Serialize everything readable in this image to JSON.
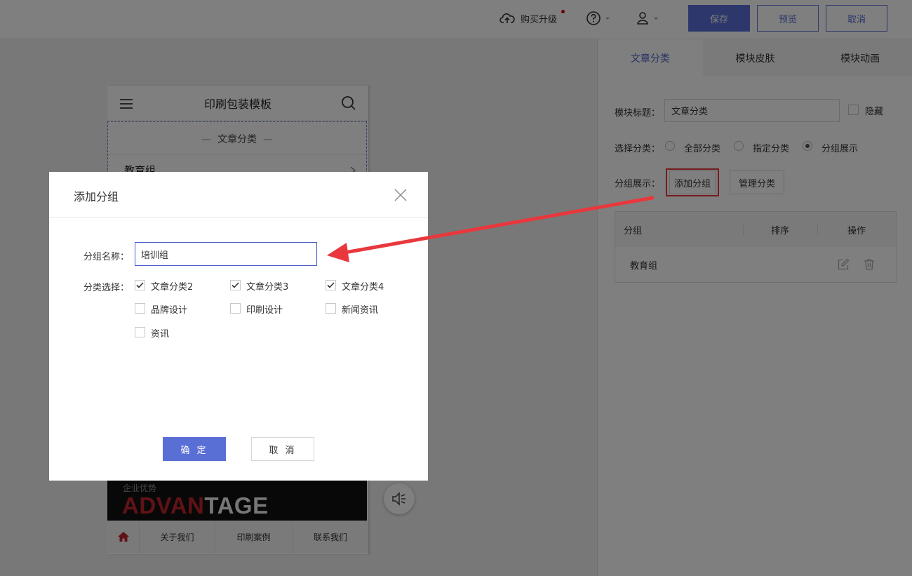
{
  "topbar": {
    "upgrade_label": "购买升级",
    "save_label": "保存",
    "preview_label": "预览",
    "cancel_label": "取消"
  },
  "phone": {
    "title": "印刷包装模板",
    "module_title": "文章分类",
    "first_row": "教育组",
    "banner_small": "企业优势",
    "banner_red": "ADVAN",
    "banner_white": "TAGE",
    "nav": [
      "关于我们",
      "印刷案例",
      "联系我们"
    ]
  },
  "panel": {
    "tabs": [
      "文章分类",
      "模块皮肤",
      "模块动画"
    ],
    "module_title_label": "模块标题：",
    "module_title_value": "文章分类",
    "hide_label": "隐藏",
    "select_label": "选择分类：",
    "radio_options": [
      "全部分类",
      "指定分类",
      "分组展示"
    ],
    "group_label": "分组展示：",
    "add_group_button": "添加分组",
    "manage_button": "管理分类",
    "table": {
      "headers": [
        "分组",
        "排序",
        "操作"
      ],
      "rows": [
        {
          "name": "教育组"
        }
      ]
    }
  },
  "dialog": {
    "title": "添加分组",
    "name_label": "分组名称：",
    "name_value": "培训组",
    "category_label": "分类选择：",
    "options": [
      {
        "label": "文章分类2",
        "checked": true
      },
      {
        "label": "文章分类3",
        "checked": true
      },
      {
        "label": "文章分类4",
        "checked": true
      },
      {
        "label": "品牌设计",
        "checked": false
      },
      {
        "label": "印刷设计",
        "checked": false
      },
      {
        "label": "新闻资讯",
        "checked": false
      },
      {
        "label": "资讯",
        "checked": false
      }
    ],
    "confirm_label": "确 定",
    "cancel_label": "取 消"
  },
  "colors": {
    "primary": "#5a6fd6",
    "highlight": "#e8383d"
  }
}
